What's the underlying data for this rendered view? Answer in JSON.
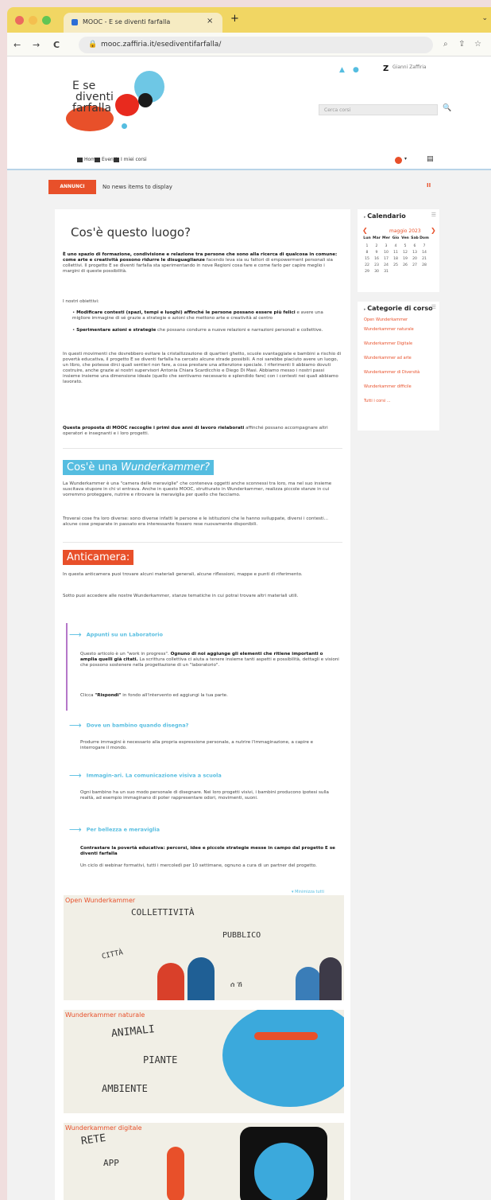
{
  "browser": {
    "tab_title": "MOOC - E se diventi farfalla",
    "tab_close": "×",
    "new_tab": "+",
    "tabs_chevron": "⌄",
    "url": "mooc.zaffiria.it/esediventifarfalla/",
    "nav": {
      "back": "←",
      "forward": "→",
      "reload": "C"
    },
    "icons": [
      "search-icon",
      "share-icon",
      "star-icon"
    ]
  },
  "header": {
    "logo_lines": [
      "E   se",
      "diventi",
      "farfalla"
    ],
    "username": "Gianni Zaffiria",
    "search_placeholder": "Cerca corsi",
    "search_icon_glyph": "🔍",
    "menu": [
      "Home",
      "Eventi",
      "I miei corsi"
    ],
    "settings_chevron": "▾",
    "grid_glyph": "▤"
  },
  "news": {
    "badge": "ANNUNCI",
    "message": "No news items to display",
    "pause": "II"
  },
  "main": {
    "title": "Cos'è questo luogo?",
    "intro_bold": "È uno spazio di formazione, condivisione e relazione tra persone che sono alla ricerca di qualcosa in comune: come arte e creatività possono ridurre le disuguaglianze",
    "intro_rest": " facendo leva sia su fattori di empowerment personali sia collettivi. Il progetto E se diventi farfalla sta sperimentando in nove Regioni cosa fare e come farlo per capire meglio i margini di queste possibilità.",
    "objectives_label": "I nostri obiettivi:",
    "objective_1_bold": "Modificare contesti (spazi, tempi e luoghi) affinché le persone possano essere più felici",
    "objective_1_rest": " e avere una migliore immagine di sé grazie a strategie e azioni che mettono arte e creatività al centro",
    "objective_2_bold": "Sperimentare azioni e strategie",
    "objective_2_rest": " che possano condurre a nuove relazioni e narrazioni personali e collettive.",
    "para_movements": "In questi movimenti che dovrebbero evitare la cristallizzazione di quartieri ghetto, scuole svantaggiate e bambini a rischio di povertà educativa, il progetto E se diventi farfalla ha cercato alcune strade possibili. A noi sarebbe piaciuto avere un luogo, un libro, che potesse dirci quali sentieri non fare, a cosa prestare una attenzione speciale. I riferimenti li abbiamo dovuti costruire, anche grazie ai nostri supervisori Antonia Chiara Scardicchio e Diego Di Masi. Abbiamo messo i nostri passi insieme insieme una dimensione ideale (quello che sentivamo necessario e splendido fare) con i contesti nei quali abbiamo lavorato.",
    "mooc_bold": "Questa proposta di MOOC raccoglie i primi due anni di lavoro rielaborati",
    "mooc_rest": " affinché possano accompagnare altri operatori e insegnanti e i loro progetti.",
    "wunder_title_a": "Cos'è una ",
    "wunder_title_b": "Wunderkammer?",
    "wunder_p1": "La Wunderkammer è una \"camera delle meraviglie\" che conteneva oggetti anche sconnessi tra loro, ma nel suo insieme suscitava stupore in chi vi entrava. Anche in questo MOOC, strutturato in Wunderkammer, realizza piccole stanze in cui vorremmo proteggere, nutrire e ritrovare la meraviglia per quello che facciamo.",
    "wunder_p2": "Troverai cose fra loro diverse: sono diverse infatti le persone e le istituzioni che le hanno sviluppate, diversi i contesti... alcune cose preparate in passato era interessante fossero rese nuovamente disponibili.",
    "anticamera_title": "Anticamera:",
    "ant_p1": "In questa anticamera puoi trovare alcuni materiali generali, alcune riflessioni, mappe e punti di riferimento.",
    "ant_p2": "Sotto puoi accedere alle nostre Wunderkammer, stanze tematiche in cui potrai trovare altri materiali utili.",
    "link_1": "Appunti su un Laboratorio",
    "link_1_desc_a": "Questo articolo è un \"work in progress\". ",
    "link_1_desc_bold": "Ognuno di noi aggiunge gli elementi che ritiene importanti o amplia quelli già citati.",
    "link_1_desc_b": " La scrittura collettiva ci aiuta a tenere insieme tanti aspetti e possibilità, dettagli e visioni che possono sostenere nella progettazione di un \"laboratorio\".",
    "link_1_cta_a": "Clicca ",
    "link_1_cta_bold": "\"Rispondi\"",
    "link_1_cta_b": " in fondo all'intervento ed aggiungi la tua parte.",
    "link_2": "Dove un bambino quando disegna?",
    "link_2_desc": "Produrre immagini è necessario alla propria espressione personale, a nutrire l'immaginazione, a capire e interrogare il mondo.",
    "link_3": "Immagin-ari. La comunicazione visiva a scuola",
    "link_3_desc": "Ogni bambino ha un suo modo personale di disegnare. Nei loro progetti visivi, i bambini producono ipotesi sulla realtà, ad esempio immaginano di poter rappresentare odori, movimenti, suoni.",
    "link_4": "Per bellezza e meraviglia",
    "link_4_bold": "Contrastare la povertà educativa: percorsi, idee e piccole strategie messe in campo dal progetto E se diventi farfalla",
    "link_4_desc": "Un ciclo di webinar formativi, tutti i mercoledì per 10 settimane, ognuno a cura di un partner del progetto.",
    "minimize": "▾ Minimizza tutti",
    "tiles": [
      {
        "title": "Open Wunderkammer",
        "words": [
          "COLLETTIVITÀ",
          "PUBBLICO",
          "CITTÀ"
        ]
      },
      {
        "title": "Wunderkammer naturale",
        "words": [
          "ANIMALI",
          "PIANTE",
          "AMBIENTE"
        ]
      },
      {
        "title": "Wunderkammer digitale",
        "words": [
          "RETE",
          "APP"
        ]
      }
    ]
  },
  "calendar": {
    "title": "Calendario",
    "month": "maggio 2023",
    "prev": "❮",
    "next": "❯",
    "weekdays": [
      "Lun",
      "Mar",
      "Mer",
      "Gio",
      "Ven",
      "Sab",
      "Dom"
    ],
    "weeks": [
      [
        "1",
        "2",
        "3",
        "4",
        "5",
        "6",
        "7"
      ],
      [
        "8",
        "9",
        "10",
        "11",
        "12",
        "13",
        "14"
      ],
      [
        "15",
        "16",
        "17",
        "18",
        "19",
        "20",
        "21"
      ],
      [
        "22",
        "23",
        "24",
        "25",
        "26",
        "27",
        "28"
      ],
      [
        "29",
        "30",
        "31",
        "",
        "",
        "",
        ""
      ]
    ]
  },
  "categories": {
    "title": "Categorie di corso",
    "items": [
      "Open Wunderkammer",
      "Wunderkammer naturale",
      "Wunderkammer Digitale",
      "Wunderkammer ad arte",
      "Wunderkammer di Diversità",
      "Wunderkammer difficile",
      "Tutti i corsi ..."
    ]
  },
  "colors": {
    "accent_orange": "#e8502a",
    "accent_blue": "#55bde0",
    "accent_purple": "#b577c9",
    "tabbar_yellow": "#f1d663"
  }
}
